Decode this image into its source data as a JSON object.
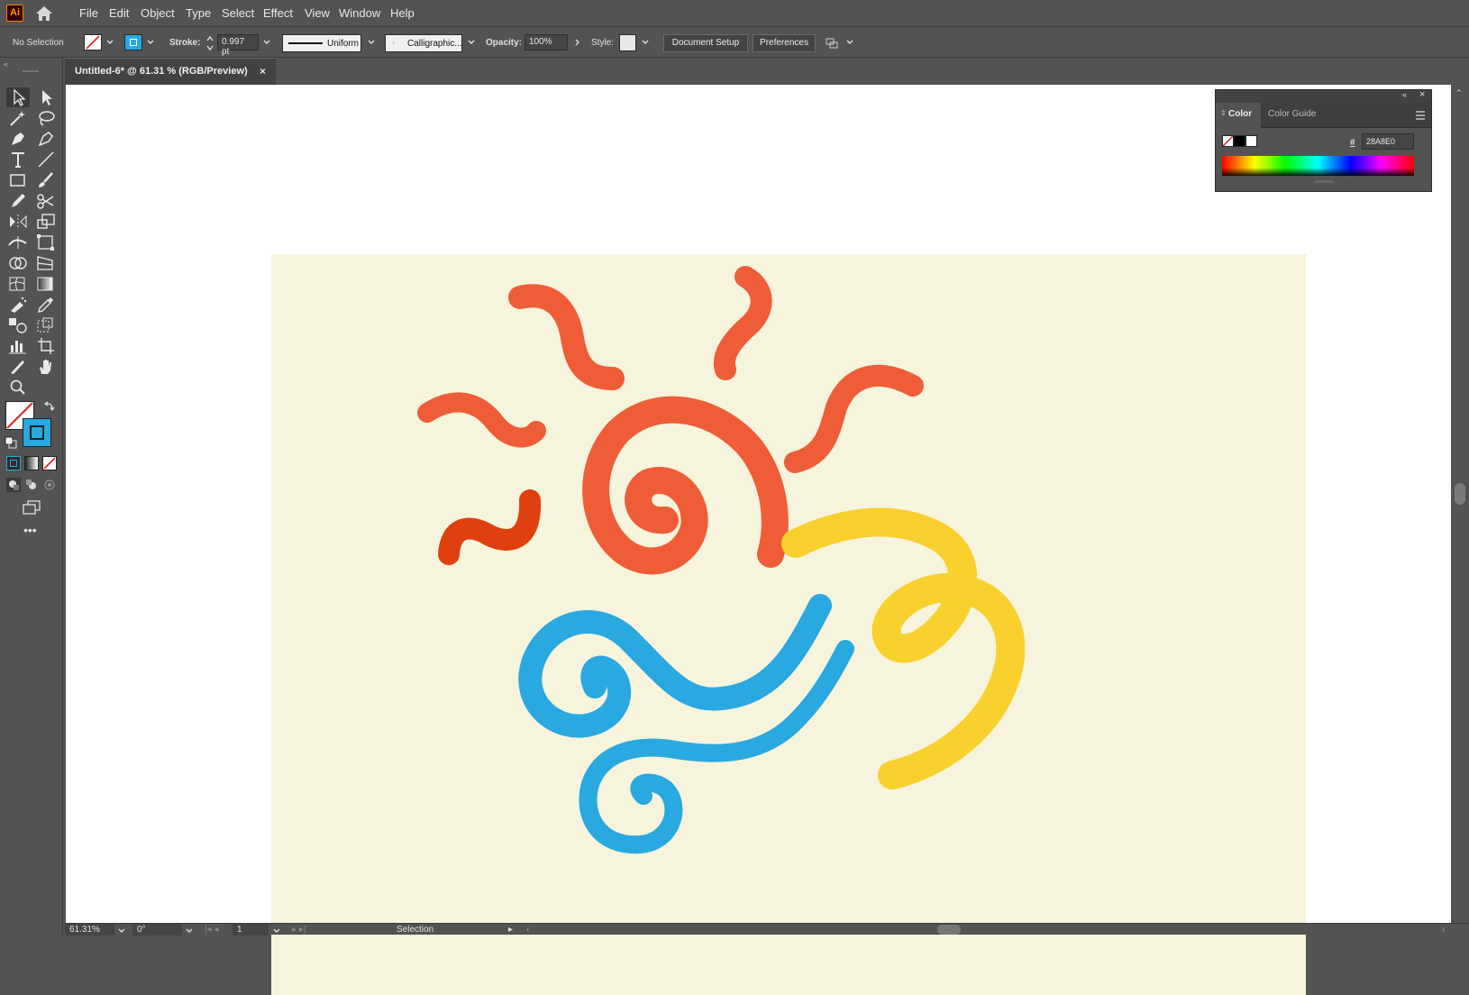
{
  "app": {
    "logo": "Ai"
  },
  "menu": [
    "File",
    "Edit",
    "Object",
    "Type",
    "Select",
    "Effect",
    "View",
    "Window",
    "Help"
  ],
  "control_bar": {
    "selection_status": "No Selection",
    "stroke_label": "Stroke:",
    "stroke_weight": "0.997 pt",
    "stroke_profile": "Uniform",
    "brush": "Calligraphic...",
    "opacity_label": "Opacity:",
    "opacity_value": "100%",
    "style_label": "Style:",
    "document_setup": "Document Setup",
    "preferences": "Preferences"
  },
  "document_tab": {
    "title": "Untitled-6* @ 61.31 % (RGB/Preview)",
    "close": "×"
  },
  "color_panel": {
    "tabs": [
      "Color",
      "Color Guide"
    ],
    "hex_label": "#",
    "hex_value": "28A8E0"
  },
  "status_bar": {
    "zoom": "61.31%",
    "rotation": "0°",
    "artboard_number": "1",
    "tool_mode": "Selection"
  },
  "colors": {
    "artboard": "#f6f4dc",
    "sun_orange": "#ef5d38",
    "sun_dark_orange": "#e04010",
    "wind_blue": "#2aa8e0",
    "swirl_yellow": "#f8d12e"
  },
  "icons": [
    "home-icon",
    "selection-tool-icon",
    "direct-selection-tool-icon",
    "magic-wand-icon",
    "lasso-icon",
    "pen-icon",
    "curvature-icon",
    "type-icon",
    "line-icon",
    "rectangle-icon",
    "paintbrush-icon",
    "pencil-icon",
    "scissors-icon",
    "reflect-icon",
    "scale-icon",
    "width-icon",
    "free-transform-icon",
    "shape-builder-icon",
    "perspective-grid-icon",
    "mesh-icon",
    "gradient-icon",
    "eyedropper-icon",
    "measure-icon",
    "symbol-sprayer-icon",
    "column-graph-icon",
    "artboard-icon",
    "slice-icon",
    "zoom-icon",
    "hand-icon",
    "swap-fill-stroke-icon",
    "default-colors-icon",
    "edit-toolbar-icon"
  ]
}
